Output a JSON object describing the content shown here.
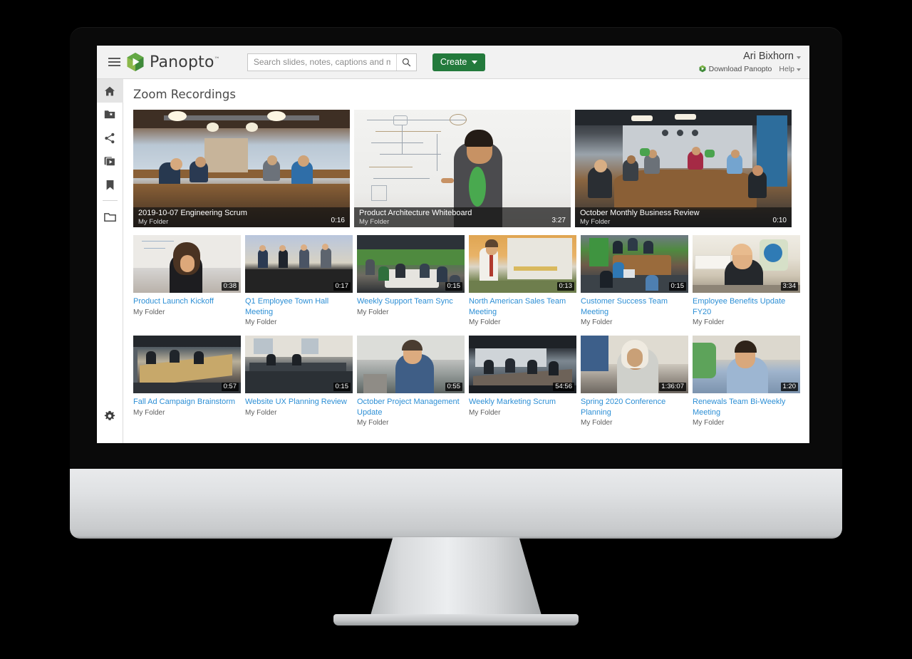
{
  "header": {
    "brand_name": "Panopto",
    "brand_tm": "™",
    "search_placeholder": "Search slides, notes, captions and more",
    "search_value": "",
    "create_label": "Create",
    "user_name": "Ari Bixhorn",
    "download_label": "Download Panopto",
    "help_label": "Help"
  },
  "sidebar": {
    "items": [
      {
        "name": "home",
        "icon": "home-icon"
      },
      {
        "name": "my-folder",
        "icon": "folder-star-icon"
      },
      {
        "name": "shared",
        "icon": "share-icon"
      },
      {
        "name": "my-videos",
        "icon": "video-library-icon"
      },
      {
        "name": "bookmarks",
        "icon": "bookmark-icon"
      },
      {
        "name": "browse",
        "icon": "folder-icon"
      }
    ],
    "settings": {
      "name": "settings",
      "icon": "gear-icon"
    }
  },
  "page": {
    "title": "Zoom Recordings"
  },
  "featured": [
    {
      "title": "2019-10-07 Engineering Scrum",
      "folder": "My Folder",
      "duration": "0:16",
      "scene": "sc-room1"
    },
    {
      "title": "Product Architecture Whiteboard",
      "folder": "My Folder",
      "duration": "3:27",
      "scene": "sc-wb"
    },
    {
      "title": "October Monthly Business Review",
      "folder": "My Folder",
      "duration": "0:10",
      "scene": "sc-room2"
    }
  ],
  "grid_row_1": [
    {
      "title": "Product Launch Kickoff",
      "folder": "My Folder",
      "duration": "0:38",
      "scene": "sc-person"
    },
    {
      "title": "Q1 Employee Town Hall Meeting",
      "folder": "My Folder",
      "duration": "0:17",
      "scene": "sc-panel"
    },
    {
      "title": "Weekly Support Team Sync",
      "folder": "My Folder",
      "duration": "0:15",
      "scene": "sc-open"
    },
    {
      "title": "North American Sales Team Meeting",
      "folder": "My Folder",
      "duration": "0:13",
      "scene": "sc-present"
    },
    {
      "title": "Customer Success Team Meeting",
      "folder": "My Folder",
      "duration": "0:15",
      "scene": "sc-green"
    },
    {
      "title": "Employee Benefits Update FY20",
      "folder": "My Folder",
      "duration": "3:34",
      "scene": "sc-office"
    }
  ],
  "grid_row_2": [
    {
      "title": "Fall Ad Campaign Brainstorm",
      "folder": "My Folder",
      "duration": "0:57",
      "scene": "sc-dark1"
    },
    {
      "title": "Website UX Planning Review",
      "folder": "My Folder",
      "duration": "0:15",
      "scene": "sc-dark2"
    },
    {
      "title": "October Project Management Update",
      "folder": "My Folder",
      "duration": "0:55",
      "scene": "sc-gray"
    },
    {
      "title": "Weekly Marketing Scrum",
      "folder": "My Folder",
      "duration": "54:56",
      "scene": "sc-board"
    },
    {
      "title": "Spring 2020 Conference Planning",
      "folder": "My Folder",
      "duration": "1:36:07",
      "scene": "sc-hijab"
    },
    {
      "title": "Renewals Team Bi-Weekly Meeting",
      "folder": "My Folder",
      "duration": "1:20",
      "scene": "sc-shirt"
    }
  ],
  "colors": {
    "brand_green": "#237a3c",
    "link_blue": "#2d8fd5",
    "header_bg": "#f2f2f2",
    "bezel": "#0a0a0a"
  }
}
